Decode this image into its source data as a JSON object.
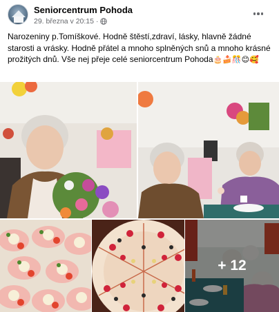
{
  "post": {
    "page_name": "Seniorcentrum Pohoda",
    "timestamp": "29. března v 20:15",
    "separator": "·",
    "caption": "Narozeniny p.Tomíškové. Hodně štěstí,zdraví, lásky, hlavně žádné starosti a vrásky. Hodně přátel a mnoho splněných snů a mnoho krásné prožitých dnů. Vše nej přeje celé seniorcentrum Pohoda",
    "caption_emojis": "🎂🍰🎊😊🥰",
    "more_photos_label": "+ 12"
  },
  "icons": {
    "avatar": "seniorcentrum-logo",
    "audience": "globe-icon",
    "menu": "more-options-icon"
  }
}
